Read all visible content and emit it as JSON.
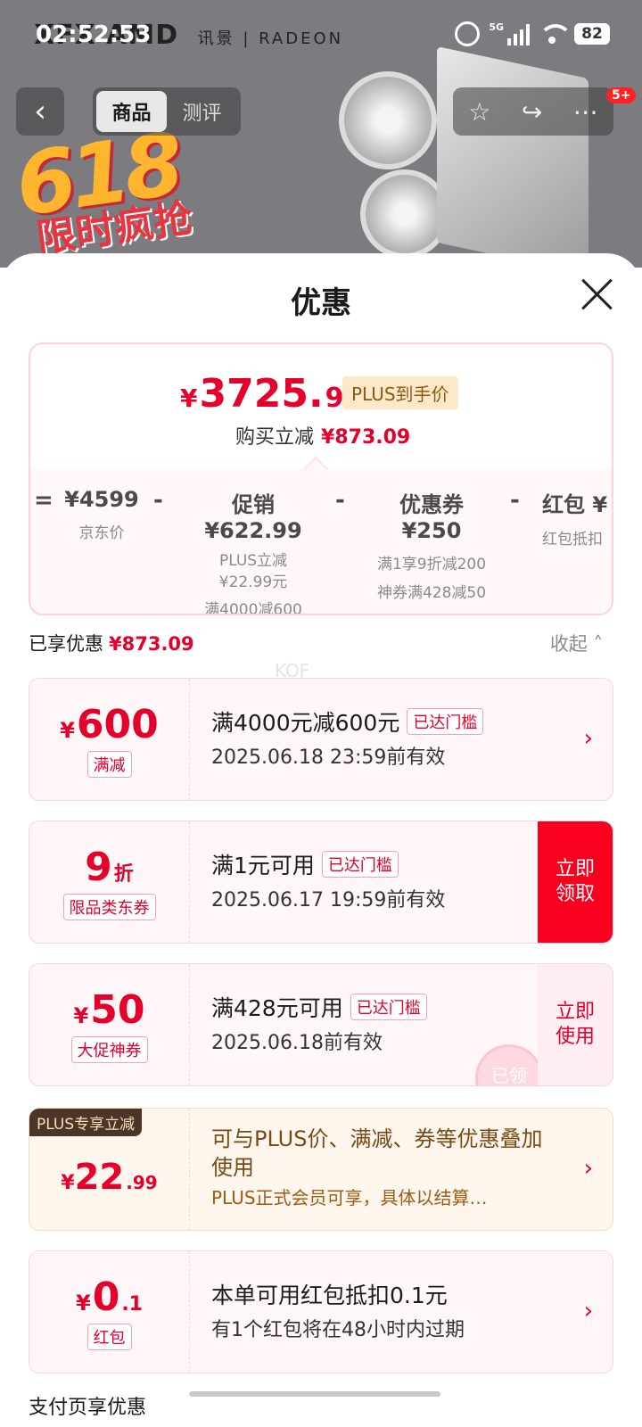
{
  "status_bar": {
    "time": "02:52:53",
    "network": "5G",
    "battery": "82"
  },
  "banner": {
    "brand": "XFX AMD",
    "brand_sub": "讯景 | RADEON",
    "event": "618",
    "slogan": "限时疯抢"
  },
  "nav": {
    "tabs": [
      "商品",
      "测评"
    ],
    "active_tab": 0,
    "badge": "5+"
  },
  "sheet": {
    "title": "优惠",
    "summary": {
      "final_price_yen": "¥",
      "final_price_int": "3725.",
      "final_price_dec": "91",
      "plus_tag": "PLUS到手价",
      "discount_label": "购买立减",
      "discount_value": "¥873.09",
      "breakdown": [
        {
          "value": "¥4599",
          "labels": [
            "京东价"
          ]
        },
        {
          "value": "促销 ¥622.99",
          "labels": [
            "PLUS立减",
            "¥22.99元",
            "满4000减600"
          ]
        },
        {
          "value": "优惠券 ¥250",
          "labels": [
            "满1享9折减200",
            "神券满428减50"
          ]
        },
        {
          "value": "红包 ¥",
          "labels": [
            "红包抵扣"
          ]
        }
      ],
      "operators": [
        "=",
        "-",
        "-",
        "-"
      ]
    },
    "enjoyed_label": "已享优惠",
    "enjoyed_value": "¥873.09",
    "collapse_label": "收起",
    "watermark": "KOF",
    "coupons": [
      {
        "yen": "¥",
        "amount": "600",
        "suffix": "",
        "chip": "满减",
        "condition": "满4000元减600元",
        "status": "已达门槛",
        "expire": "2025.06.18 23:59前有效",
        "action": ""
      },
      {
        "yen": "",
        "amount": "9",
        "suffix": "折",
        "chip": "限品类东券",
        "condition": "满1元可用",
        "status": "已达门槛",
        "expire": "2025.06.17 19:59前有效",
        "action": "立即领取"
      },
      {
        "yen": "¥",
        "amount": "50",
        "suffix": "",
        "chip": "大促神券",
        "condition": "满428元可用",
        "status": "已达门槛",
        "expire": "2025.06.18前有效",
        "action": "立即使用",
        "stamp": "已领"
      }
    ],
    "plus_card": {
      "badge": "PLUS专享立减",
      "yen": "¥",
      "amount": "22",
      "decimal": ".99",
      "desc": "可与PLUS价、满减、券等优惠叠加使用",
      "sub": "PLUS正式会员可享，具体以结算…"
    },
    "redpacket": {
      "yen": "¥",
      "amount": "0",
      "decimal": ".1",
      "chip": "红包",
      "condition": "本单可用红包抵扣0.1元",
      "expire": "有1个红包将在48小时内过期"
    },
    "footer": "支付页享优惠"
  },
  "colors": {
    "accent": "#e4002b",
    "action": "#f8001e",
    "plus": "#4a3528"
  }
}
